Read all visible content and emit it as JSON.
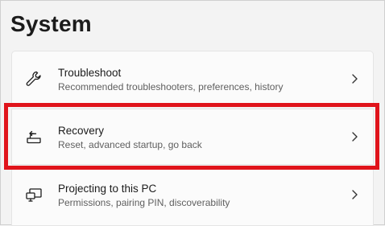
{
  "header": {
    "title": "System"
  },
  "items": [
    {
      "title": "Troubleshoot",
      "subtitle": "Recommended troubleshooters, preferences, history",
      "icon": "wrench-icon"
    },
    {
      "title": "Recovery",
      "subtitle": "Reset, advanced startup, go back",
      "icon": "recovery-icon"
    },
    {
      "title": "Projecting to this PC",
      "subtitle": "Permissions, pairing PIN, discoverability",
      "icon": "projecting-icon"
    }
  ],
  "highlight": {
    "target": "Recovery",
    "color": "#e0141b"
  },
  "colors": {
    "background": "#f3f3f3",
    "card": "#fbfbfb",
    "text": "#1b1b1b",
    "subtext": "#5f5f5f"
  }
}
